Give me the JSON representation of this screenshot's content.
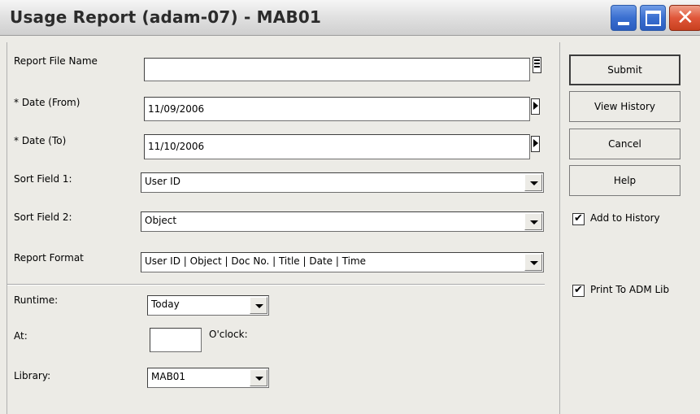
{
  "window": {
    "title": "Usage Report (adam-07) - MAB01"
  },
  "form": {
    "report_file_name": {
      "label": "Report File Name",
      "value": ""
    },
    "date_from": {
      "label": "* Date (From)",
      "value": "11/09/2006"
    },
    "date_to": {
      "label": "* Date (To)",
      "value": "11/10/2006"
    },
    "sort_field_1": {
      "label": "Sort Field 1:",
      "value": "User ID"
    },
    "sort_field_2": {
      "label": "Sort Field 2:",
      "value": "Object"
    },
    "report_format": {
      "label": "Report Format",
      "value": "User ID | Object | Doc No. | Title | Date | Time"
    },
    "runtime": {
      "label": "Runtime:",
      "value": "Today"
    },
    "at": {
      "label": "At:",
      "value": "",
      "suffix": "O'clock:"
    },
    "library": {
      "label": "Library:",
      "value": "MAB01"
    }
  },
  "buttons": {
    "submit": "Submit",
    "view_history": "View History",
    "cancel": "Cancel",
    "help": "Help"
  },
  "options": {
    "add_to_history": {
      "label": "Add to History",
      "checked": true
    },
    "print_to_adm_lib": {
      "label": "Print To ADM Lib",
      "checked": true
    }
  },
  "icons": {
    "minimize": "minimize-icon",
    "maximize": "maximize-icon",
    "close": "close-icon",
    "file_browse": "file-browse-icon",
    "date_picker": "arrow-right-icon",
    "dropdown": "chevron-down-icon",
    "checkmark": "checkmark-icon"
  },
  "colors": {
    "window_bg": "#ecebe6",
    "titlebar_text": "#2b2b2b",
    "title_button_blue": "#3a6fd0",
    "close_button_red": "#e0573a"
  }
}
